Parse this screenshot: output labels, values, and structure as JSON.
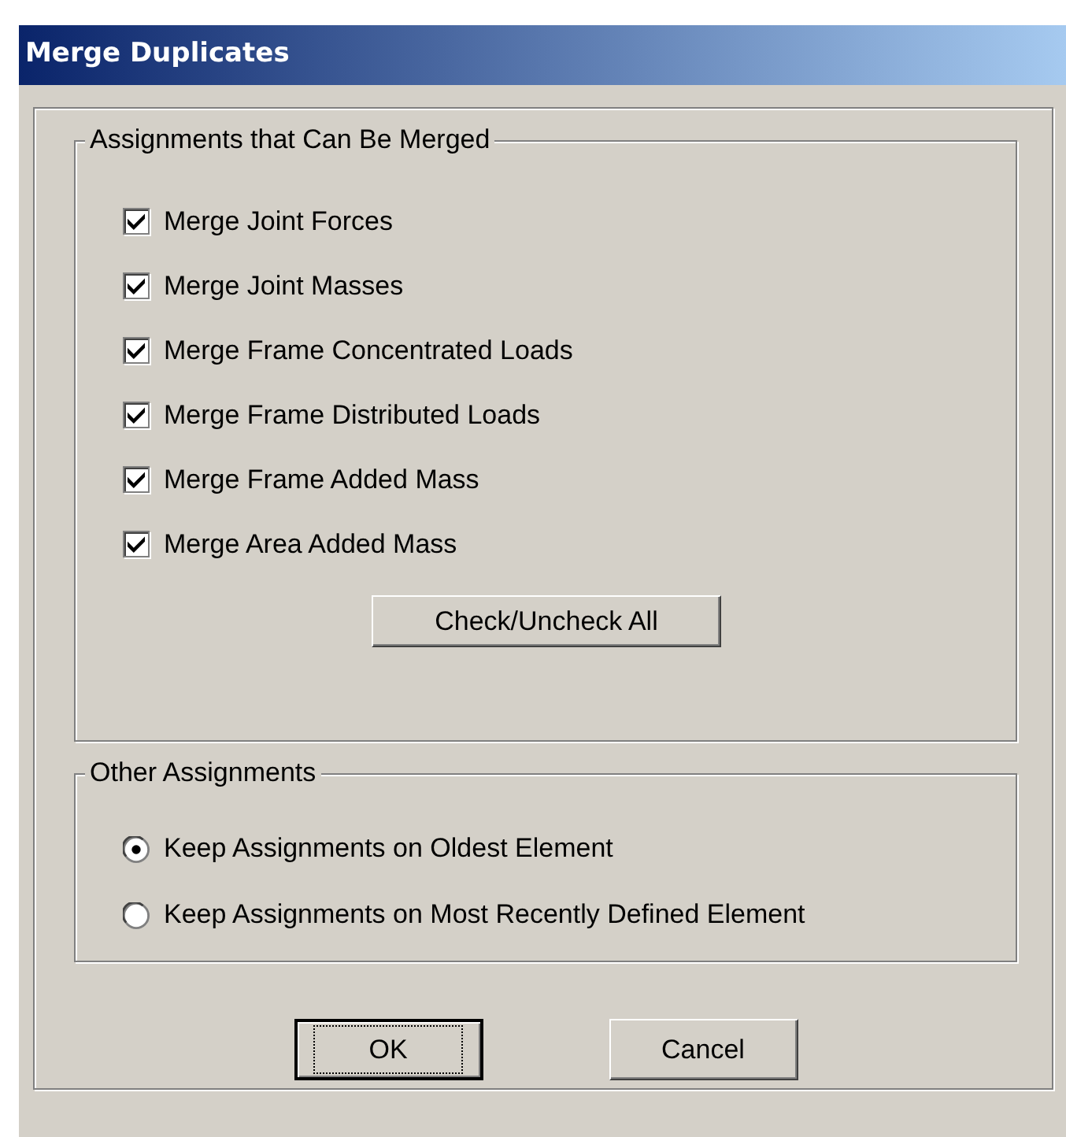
{
  "window": {
    "title": "Merge Duplicates"
  },
  "merge_group": {
    "title": "Assignments that Can Be Merged",
    "options": [
      {
        "label": "Merge Joint Forces",
        "checked": true
      },
      {
        "label": "Merge Joint Masses",
        "checked": true
      },
      {
        "label": "Merge Frame Concentrated Loads",
        "checked": true
      },
      {
        "label": "Merge Frame Distributed Loads",
        "checked": true
      },
      {
        "label": "Merge Frame Added Mass",
        "checked": true
      },
      {
        "label": "Merge Area Added Mass",
        "checked": true
      }
    ],
    "toggle_button": "Check/Uncheck All"
  },
  "other_group": {
    "title": "Other Assignments",
    "options": [
      {
        "label": "Keep Assignments on Oldest Element",
        "selected": true
      },
      {
        "label": "Keep Assignments on Most Recently Defined Element",
        "selected": false
      }
    ]
  },
  "buttons": [
    {
      "label": "OK",
      "focused": true
    },
    {
      "label": "Cancel",
      "focused": false
    }
  ]
}
